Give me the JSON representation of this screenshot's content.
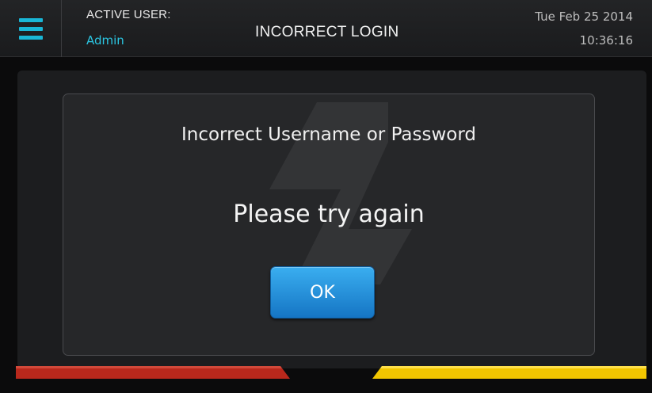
{
  "header": {
    "active_user_label": "ACTIVE USER:",
    "active_user_name": "Admin",
    "title": "INCORRECT LOGIN",
    "date": "Tue Feb 25 2014",
    "time": "10:36:16"
  },
  "dialog": {
    "message": "Incorrect Username or Password",
    "prompt": "Please try again",
    "ok_label": "OK"
  },
  "colors": {
    "accent": "#19b6d6",
    "button": "#1f8fdc",
    "stripe_left": "#b8281c",
    "stripe_right": "#f2c600"
  }
}
